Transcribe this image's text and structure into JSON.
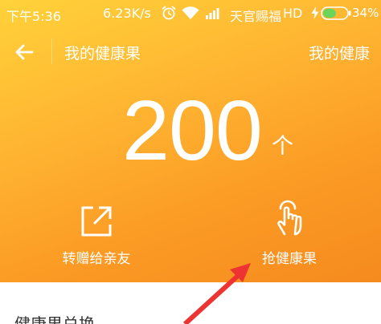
{
  "status_bar": {
    "time": "下午5:36",
    "network_speed": "6.23K/s",
    "carrier": "天官赐福",
    "network_type": "HD",
    "battery": "34%"
  },
  "header": {
    "title": "我的健康果",
    "right_link": "我的健康"
  },
  "balance": {
    "count": "200",
    "unit": "个"
  },
  "actions": [
    {
      "label": "转赠给亲友",
      "icon": "share-icon"
    },
    {
      "label": "抢健康果",
      "icon": "hand-tap-icon"
    }
  ],
  "exchange": {
    "title": "健康果兑换"
  },
  "colors": {
    "accent": "#fba42a",
    "accent_light": "#ffd23a",
    "annotation": "#ee3333",
    "battery_fill": "#6bd45a"
  }
}
